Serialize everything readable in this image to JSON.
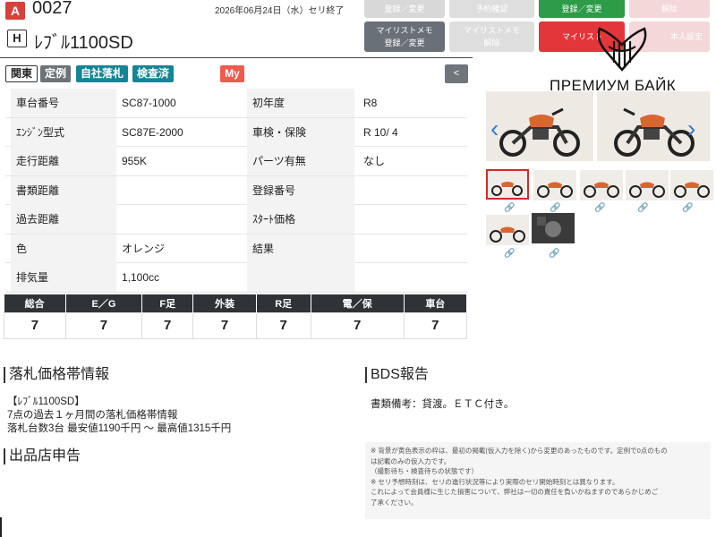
{
  "header": {
    "lot_badge": "A",
    "lot_number": "0027",
    "date": "2026年06月24日（水）セリ終了",
    "h_badge": "H",
    "model": "ﾚﾌﾞﾙ1100SD"
  },
  "top_buttons": {
    "b1": "登録／変更",
    "b2": "予約確認",
    "b3": "登録／変更",
    "b4": "解除",
    "memo": "マイリストメモ",
    "memo_sub": "登録／変更",
    "memo2": "マイリストメモ",
    "memo2_sub": "解除",
    "mylist": "マイリスト",
    "custom": "本人設定"
  },
  "watermark": {
    "text": "ПРЕМИУМ БАЙК"
  },
  "tags": {
    "kanto": "関東",
    "teirei": "定例",
    "jisha": "自社落札",
    "kensa": "検査済",
    "my": "My",
    "toggle": "<"
  },
  "spec": {
    "rows": [
      {
        "l1": "車台番号",
        "v1": "SC87-1000",
        "l2": "初年度",
        "v2": "R8"
      },
      {
        "l1": "ｴﾝｼﾞﾝ型式",
        "v1": "SC87E-2000",
        "l2": "車検・保険",
        "v2": "R 10/ 4"
      },
      {
        "l1": "走行距離",
        "v1": "955K",
        "l2": "パーツ有無",
        "v2": "なし"
      },
      {
        "l1": "書類距離",
        "v1": "",
        "l2": "登録番号",
        "v2": ""
      },
      {
        "l1": "過去距離",
        "v1": "",
        "l2": "ｽﾀｰﾄ価格",
        "v2": ""
      },
      {
        "l1": "色",
        "v1": "オレンジ",
        "l2": "結果",
        "v2": ""
      },
      {
        "l1": "排気量",
        "v1": "1,100cc",
        "l2": "",
        "v2": ""
      }
    ]
  },
  "grades": {
    "headers": [
      "総合",
      "E／G",
      "F足",
      "外装",
      "R足",
      "電／保",
      "車台"
    ],
    "values": [
      "7",
      "7",
      "7",
      "7",
      "7",
      "7",
      "7"
    ]
  },
  "bid_info": {
    "title": "落札価格帯情報",
    "line1": "【ﾚﾌﾞﾙ1100SD】",
    "line2": "7点の過去１ヶ月間の落札価格帯情報",
    "line3": "落札台数3台 最安値1190千円 〜 最高値1315千円"
  },
  "bds": {
    "title": "BDS報告",
    "text": "書類備考：貸渡。ＥＴＣ付き。"
  },
  "seller": {
    "title": "出品店申告"
  },
  "notes": {
    "n1": "※ 背景が黄色表示の枠は、最初の掲載(仮入力を除く)から変更のあったものです。定例で0点のもの",
    "n2": "は記載のみの仮入力です。",
    "n3": "（撮影待ち・検査待ちの状態です）",
    "n4": "※ セリ予想時刻は、セリの進行状況等により実際のセリ開始時刻とは異なります。",
    "n5": "これによって会員様に生じた損害について、弊社は一切の責任を負いかねますのであらかじめご",
    "n6": "了承ください。"
  }
}
